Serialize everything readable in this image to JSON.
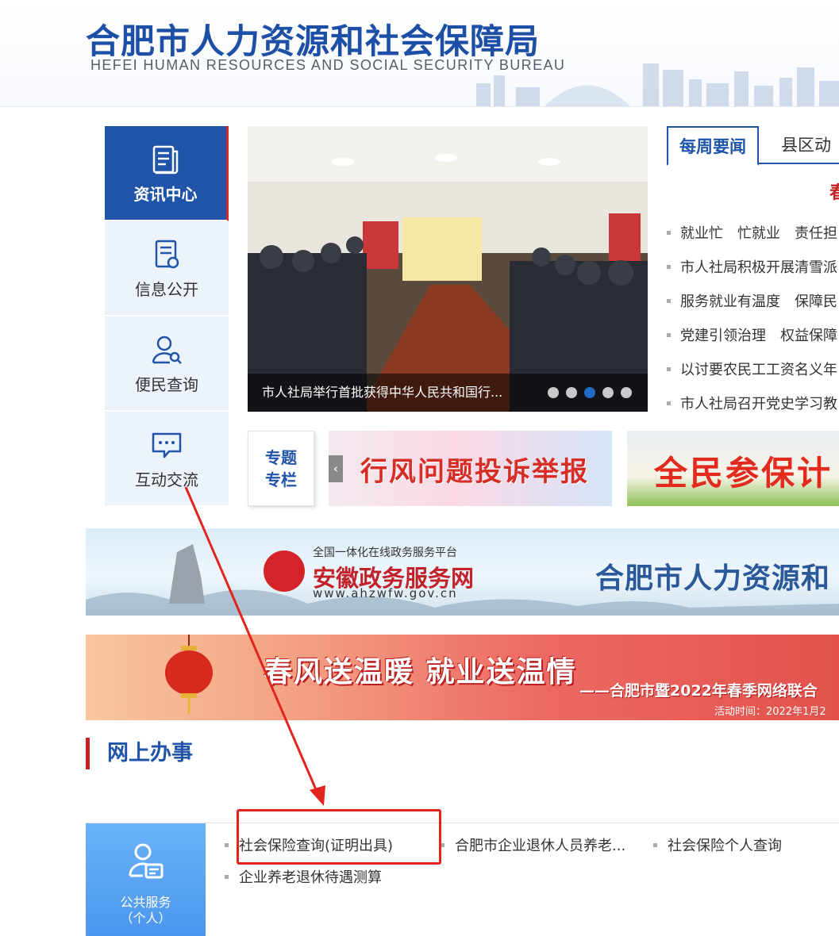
{
  "header": {
    "title": "合肥市人力资源和社会保障局",
    "subtitle": "HEFEI HUMAN RESOURCES AND SOCIAL SECURITY BUREAU"
  },
  "nav": {
    "items": [
      {
        "label": "资讯中心",
        "icon": "news-icon",
        "active": true
      },
      {
        "label": "信息公开",
        "icon": "document-icon",
        "active": false
      },
      {
        "label": "便民查询",
        "icon": "user-search-icon",
        "active": false
      },
      {
        "label": "互动交流",
        "icon": "chat-icon",
        "active": false
      }
    ]
  },
  "carousel": {
    "caption": "市人社局举行首批获得中华人民共和国行...",
    "dots": 5,
    "active_dot": 3
  },
  "news": {
    "tabs": [
      "每周要闻",
      "县区动"
    ],
    "headline": "春",
    "items": [
      "就业忙　忙就业　责任担",
      "市人社局积极开展清雪派",
      "服务就业有温度　保障民",
      "党建引领治理　权益保障",
      "以讨要农民工工资名义年",
      "市人社局召开党史学习教"
    ]
  },
  "special": {
    "label_line1": "专题",
    "label_line2": "专栏",
    "banner1": "行风问题投诉举报",
    "banner2": "全民参保计"
  },
  "gov_banner": {
    "small": "全国一体化在线政务服务平台",
    "main": "安徽政务服务网",
    "url": "www.ahzwfw.gov.cn",
    "right": "合肥市人力资源和"
  },
  "spring_banner": {
    "main": "春风送温暖  就业送温情",
    "sub": "——合肥市暨2022年春季网络联合",
    "time": "活动时间：2022年1月2"
  },
  "online": {
    "title": "网上办事",
    "card_line1": "公共服务",
    "card_line2": "（个人）",
    "links": [
      "社会保险查询(证明出具)",
      "合肥市企业退休人员养老...",
      "社会保险个人查询",
      "企业养老退休待遇测算"
    ]
  },
  "colors": {
    "brand_blue": "#1f54a8",
    "accent_red": "#c62424",
    "annotation_red": "#e3241e"
  }
}
